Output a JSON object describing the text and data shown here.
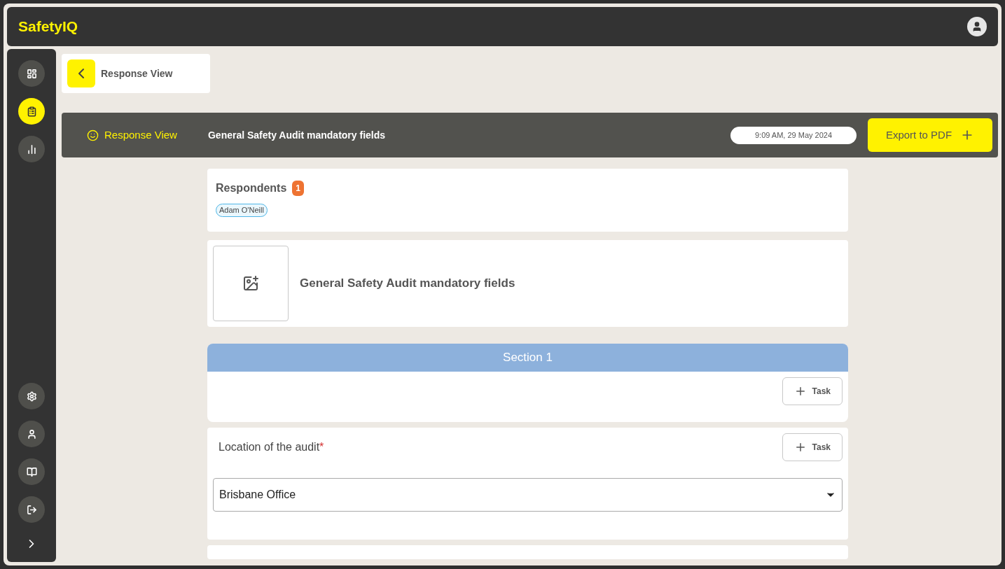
{
  "app": {
    "logo": "SafetyIQ"
  },
  "sidebar": {
    "top": [
      {
        "kind": "dashboard",
        "selected": false
      },
      {
        "kind": "clipboard",
        "selected": true
      },
      {
        "kind": "chart",
        "selected": false
      }
    ],
    "bottom": [
      {
        "kind": "settings",
        "selected": false
      },
      {
        "kind": "person",
        "selected": false
      },
      {
        "kind": "book",
        "selected": false
      },
      {
        "kind": "logout",
        "selected": false
      }
    ]
  },
  "page_header": {
    "title": "Response View"
  },
  "toolbar": {
    "breadcrumb": "Response View",
    "title": "General Safety Audit mandatory fields",
    "timestamp": "9:09 AM, 29 May 2024",
    "export_button": "Export to PDF"
  },
  "respondents": {
    "title": "Respondents",
    "count": "1",
    "people": [
      "Adam O'Neill"
    ]
  },
  "form_header": {
    "title": "General Safety Audit mandatory fields"
  },
  "section": {
    "title": "Section 1",
    "task_button": "Task"
  },
  "questions": [
    {
      "label": "Location of the audit",
      "required_mark": "*",
      "task_button": "Task",
      "value": "Brisbane Office"
    }
  ]
}
